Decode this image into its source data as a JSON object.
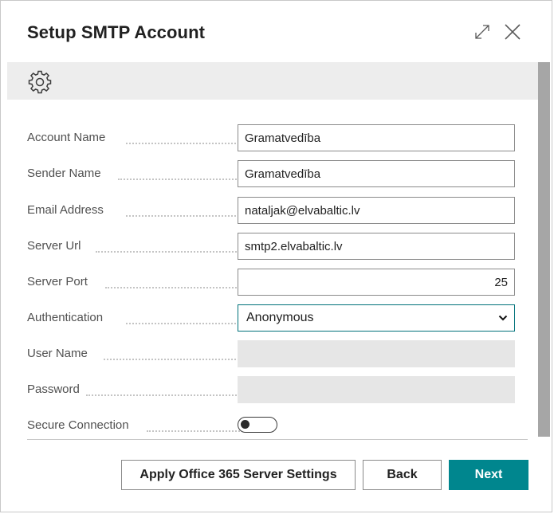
{
  "dialog": {
    "title": "Setup SMTP Account",
    "icons": [
      "expand-icon",
      "close-icon"
    ]
  },
  "toolbar": {
    "icon": "gear-icon"
  },
  "fields": {
    "account_name": {
      "label": "Account Name",
      "value": "Gramatvedība"
    },
    "sender_name": {
      "label": "Sender Name",
      "value": "Gramatvedība"
    },
    "email_address": {
      "label": "Email Address",
      "value": "nataljak@elvabaltic.lv"
    },
    "server_url": {
      "label": "Server Url",
      "value": "smtp2.elvabaltic.lv"
    },
    "server_port": {
      "label": "Server Port",
      "value": "25"
    },
    "authentication": {
      "label": "Authentication",
      "value": "Anonymous"
    },
    "user_name": {
      "label": "User Name",
      "value": ""
    },
    "password": {
      "label": "Password",
      "value": ""
    },
    "secure_connection": {
      "label": "Secure Connection",
      "on": false
    }
  },
  "footer": {
    "apply_label": "Apply Office 365 Server Settings",
    "back_label": "Back",
    "next_label": "Next"
  },
  "colors": {
    "accent": "#00868e",
    "toolbar_bg": "#ededed",
    "disabled_bg": "#e6e6e6",
    "scrollbar": "#a6a6a6"
  }
}
